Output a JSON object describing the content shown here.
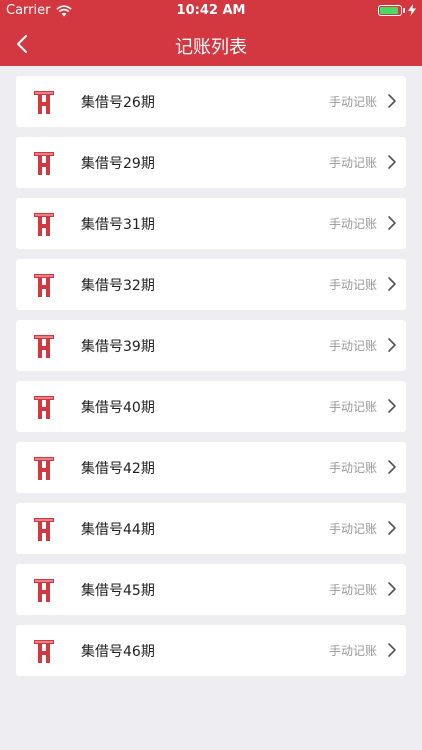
{
  "status_bar": {
    "carrier": "Carrier",
    "time": "10:42 AM",
    "battery_level": 0.9,
    "battery_color": "#4cd964"
  },
  "nav": {
    "title": "记账列表",
    "back_icon": "chevron-left-icon",
    "background_color": "#d33840"
  },
  "items": [
    {
      "title": "集借号26期",
      "tag": "手动记账",
      "icon": "brand-logo-icon"
    },
    {
      "title": "集借号29期",
      "tag": "手动记账",
      "icon": "brand-logo-icon"
    },
    {
      "title": "集借号31期",
      "tag": "手动记账",
      "icon": "brand-logo-icon"
    },
    {
      "title": "集借号32期",
      "tag": "手动记账",
      "icon": "brand-logo-icon"
    },
    {
      "title": "集借号39期",
      "tag": "手动记账",
      "icon": "brand-logo-icon"
    },
    {
      "title": "集借号40期",
      "tag": "手动记账",
      "icon": "brand-logo-icon"
    },
    {
      "title": "集借号42期",
      "tag": "手动记账",
      "icon": "brand-logo-icon"
    },
    {
      "title": "集借号44期",
      "tag": "手动记账",
      "icon": "brand-logo-icon"
    },
    {
      "title": "集借号45期",
      "tag": "手动记账",
      "icon": "brand-logo-icon"
    },
    {
      "title": "集借号46期",
      "tag": "手动记账",
      "icon": "brand-logo-icon"
    }
  ]
}
